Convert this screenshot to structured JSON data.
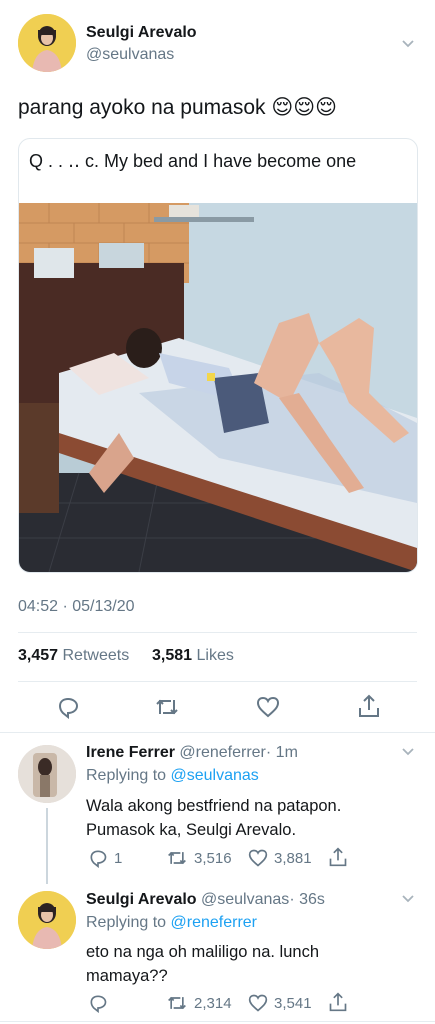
{
  "tweet": {
    "author_name": "Seulgi Arevalo",
    "author_handle": "@seulvanas",
    "text": "parang ayoko na pumasok 😌😌😌",
    "quote_text": "Q                    .    .    ‥ ᴄ. My bed and I have become one",
    "timestamp": "04:52 · 05/13/20",
    "retweets_count": "3,457",
    "retweets_label": "Retweets",
    "likes_count": "3,581",
    "likes_label": "Likes"
  },
  "replies": [
    {
      "author_name": "Irene Ferrer",
      "author_handle": "@reneferrer",
      "time": "· 1m",
      "replying_prefix": "Replying to",
      "replying_to": "@seulvanas",
      "text": "Wala akong bestfriend na patapon. Pumasok ka, Seulgi Arevalo.",
      "reply_count": "1",
      "retweet_count": "3,516",
      "like_count": "3,881"
    },
    {
      "author_name": "Seulgi Arevalo",
      "author_handle": "@seulvanas",
      "time": "· 36s",
      "replying_prefix": "Replying to",
      "replying_to": "@reneferrer",
      "text": "eto na nga oh maliligo na. lunch mamaya??",
      "reply_count": "",
      "retweet_count": "2,314",
      "like_count": "3,541"
    }
  ],
  "icons": [
    "chevron-down-icon",
    "reply-icon",
    "retweet-icon",
    "like-icon",
    "share-icon"
  ],
  "colors": {
    "accent": "#1da1f2",
    "secondary": "#657786",
    "text": "#14171a",
    "divider": "#e6ecf0"
  }
}
